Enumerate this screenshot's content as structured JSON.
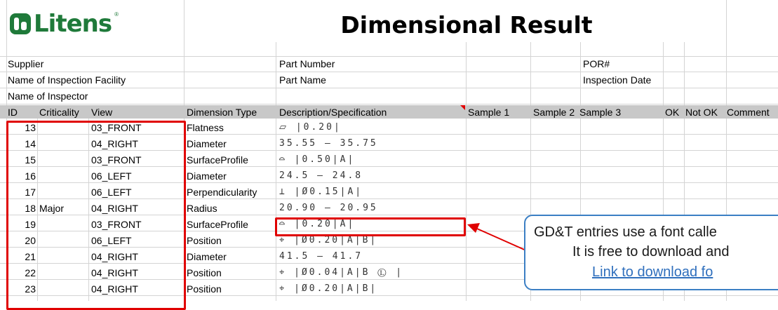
{
  "brand": {
    "logo_text": "Litens",
    "registered": "®"
  },
  "title": "Dimensional Result",
  "info": {
    "supplier": "Supplier",
    "inspection_facility": "Name of Inspection Facility",
    "inspector": "Name of Inspector",
    "part_number": "Part Number",
    "part_name": "Part Name",
    "por": "POR#",
    "inspection_date": "Inspection Date"
  },
  "columns": {
    "id": "ID",
    "criticality": "Criticality",
    "view": "View",
    "dimension_type": "Dimension Type",
    "description": "Description/Specification",
    "sample1": "Sample 1",
    "sample2": "Sample 2",
    "sample3": "Sample 3",
    "ok": "OK",
    "not_ok": "Not OK",
    "comment": "Comment"
  },
  "rows": [
    {
      "id": "13",
      "criticality": "",
      "view": "03_FRONT",
      "type": "Flatness",
      "spec": "⏥ |0.20|"
    },
    {
      "id": "14",
      "criticality": "",
      "view": "04_RIGHT",
      "type": "Diameter",
      "spec": "35.55 – 35.75"
    },
    {
      "id": "15",
      "criticality": "",
      "view": "03_FRONT",
      "type": "SurfaceProfile",
      "spec": "⌓ |0.50|A|"
    },
    {
      "id": "16",
      "criticality": "",
      "view": "06_LEFT",
      "type": "Diameter",
      "spec": "24.5 – 24.8"
    },
    {
      "id": "17",
      "criticality": "",
      "view": "06_LEFT",
      "type": "Perpendicularity",
      "spec": "⊥ |Ø0.15|A|"
    },
    {
      "id": "18",
      "criticality": "Major",
      "view": "04_RIGHT",
      "type": "Radius",
      "spec": "20.90 – 20.95"
    },
    {
      "id": "19",
      "criticality": "",
      "view": "03_FRONT",
      "type": "SurfaceProfile",
      "spec": "⌓ |0.20|A|"
    },
    {
      "id": "20",
      "criticality": "",
      "view": "06_LEFT",
      "type": "Position",
      "spec": "⌖ |Ø0.20|A|B|"
    },
    {
      "id": "21",
      "criticality": "",
      "view": "04_RIGHT",
      "type": "Diameter",
      "spec": "41.5 – 41.7"
    },
    {
      "id": "22",
      "criticality": "",
      "view": "04_RIGHT",
      "type": "Position",
      "spec": "⌖ |Ø0.04|A|B Ⓛ |"
    },
    {
      "id": "23",
      "criticality": "",
      "view": "04_RIGHT",
      "type": "Position",
      "spec": "⌖ |Ø0.20|A|B|"
    }
  ],
  "callout": {
    "line1": "GD&T entries use a font calle",
    "line2": "It is free to download and",
    "link": "Link to download fo"
  },
  "colors": {
    "accent_red": "#e00000",
    "brand_green": "#1f7a3a",
    "callout_border": "#3b7fc4",
    "header_band": "#c8c8c8"
  }
}
